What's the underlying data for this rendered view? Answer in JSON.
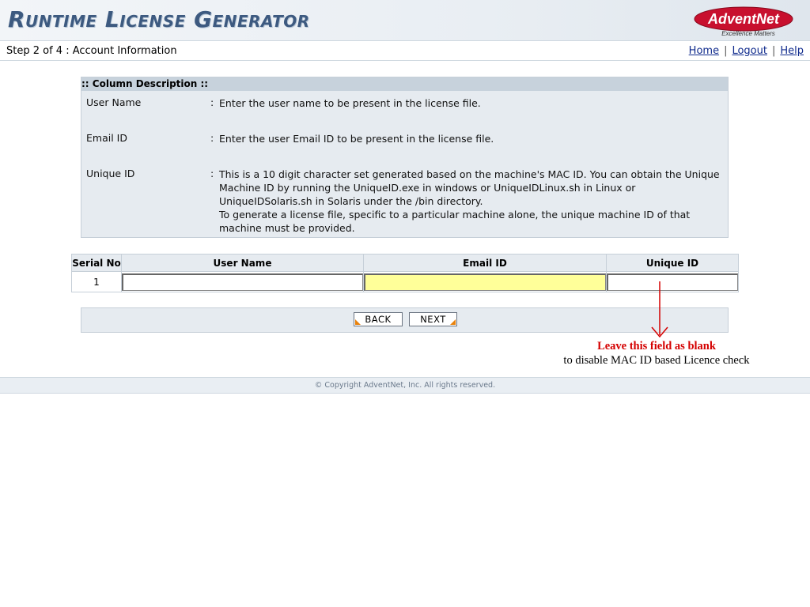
{
  "header": {
    "title": "Runtime License Generator",
    "logo_text": "AdventNet",
    "logo_tagline": "Excellence Matters"
  },
  "stepbar": {
    "step": "Step 2 of 4 : Account Information",
    "links": [
      "Home",
      "Logout",
      "Help"
    ]
  },
  "description": {
    "heading": ":: Column Description ::",
    "rows": [
      {
        "name": "User Name",
        "sep": ":",
        "text": "Enter the user name to be present in the license file."
      },
      {
        "name": "Email ID",
        "sep": ":",
        "text": "Enter the user Email ID to be present in the license file."
      },
      {
        "name": "Unique ID",
        "sep": ":",
        "text": "This is a 10 digit character set generated based on the machine's MAC ID. You can obtain the Unique Machine ID by running the UniqueID.exe in windows or UniqueIDLinux.sh in Linux or UniqueIDSolaris.sh in Solaris under the /bin directory.",
        "text2": "To generate a license file, specific to a particular machine alone, the unique machine ID of that machine must be provided."
      }
    ]
  },
  "grid": {
    "columns": [
      "Serial No",
      "User Name",
      "Email ID",
      "Unique ID"
    ],
    "rows": [
      {
        "serial": "1",
        "user_name": "",
        "email_id": "",
        "unique_id": ""
      }
    ]
  },
  "buttons": {
    "back": "BACK",
    "next": "NEXT"
  },
  "annotation": {
    "line1": "Leave this field as blank",
    "line2": "to disable MAC ID based Licence check",
    "color": "#d40000"
  },
  "footer": {
    "copyright": "© Copyright AdventNet, Inc. All rights reserved."
  },
  "colors": {
    "title": "#3d5a80",
    "link": "#0f2a8c",
    "accent": "#e8820c",
    "panel": "#e6ebf0",
    "highlight": "#ffff99"
  }
}
